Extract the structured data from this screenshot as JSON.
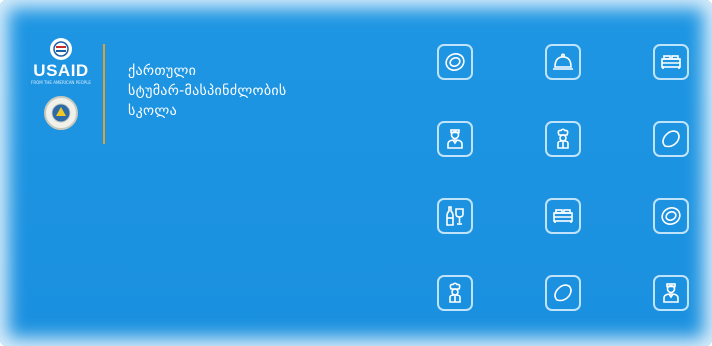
{
  "colors": {
    "background": "#1e96e3",
    "accent_divider": "#d9a236",
    "icon_stroke": "#ffffff"
  },
  "logo": {
    "usaid_text": "USAID",
    "usaid_subtext": "FROM THE AMERICAN PEOPLE"
  },
  "school_name": {
    "line1": "ქართული",
    "line2": "სტუმარ-მასპინძლობის",
    "line3": "სკოლა"
  },
  "icon_grid": [
    [
      "plate-icon",
      "cloche-icon",
      "bed-icon"
    ],
    [
      "waiter-icon",
      "chef-icon",
      "bread-icon"
    ],
    [
      "wine-icon",
      "bed-icon",
      "plate-icon"
    ],
    [
      "chef-icon",
      "bread-icon",
      "waiter-icon"
    ]
  ]
}
